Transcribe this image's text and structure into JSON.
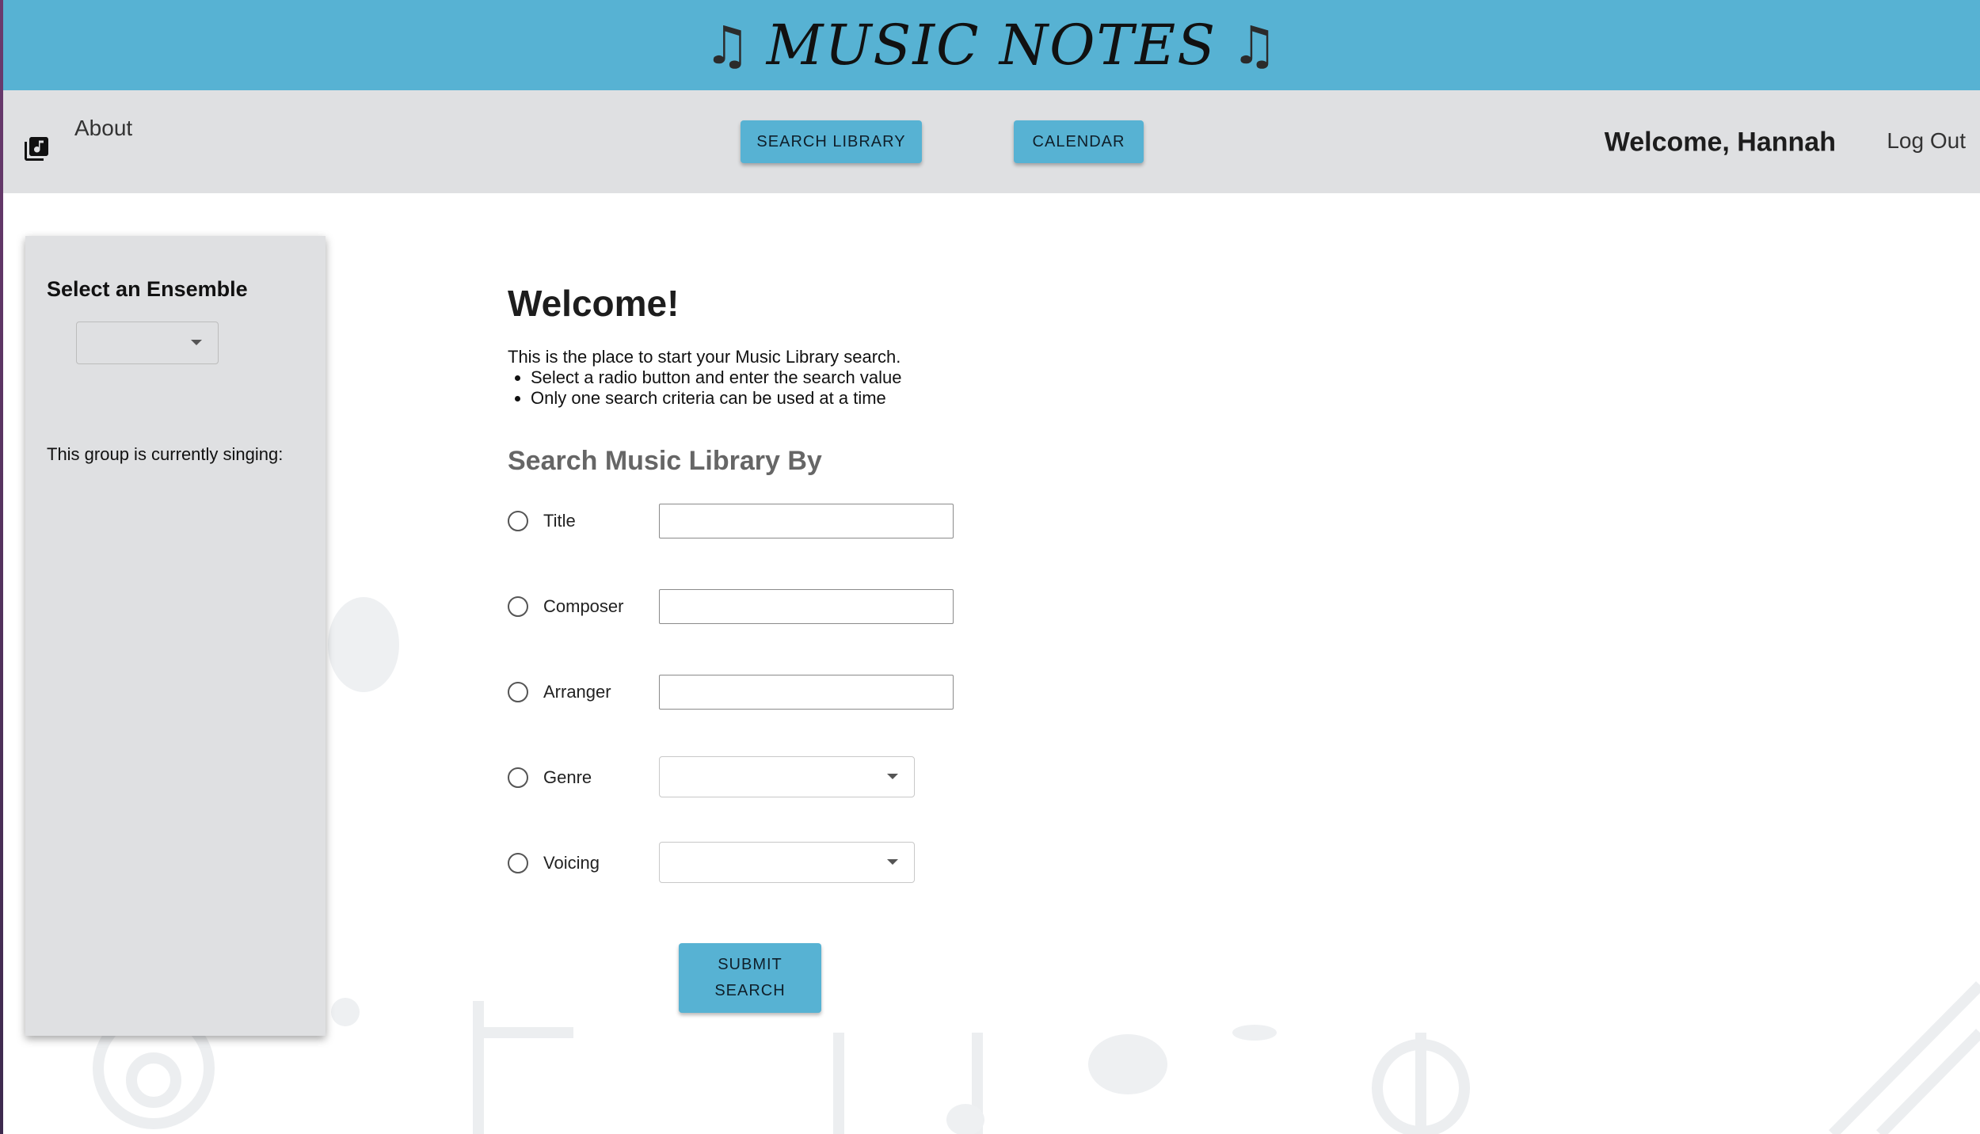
{
  "header": {
    "title": "MUSIC NOTES",
    "note_glyph": "♫",
    "background": "#57b2d3"
  },
  "nav": {
    "about": "About",
    "search_library": "SEARCH LIBRARY",
    "calendar": "CALENDAR",
    "welcome": "Welcome, Hannah",
    "logout": "Log Out",
    "icon": "music-library-icon"
  },
  "sidebar": {
    "title": "Select an Ensemble",
    "ensemble_value": "",
    "singing_text": "This group is currently singing:"
  },
  "main": {
    "title": "Welcome!",
    "intro": "This is the place to start your Music Library search.",
    "bullets": [
      "Select a radio button and enter the search value",
      "Only one search criteria can be used at a time"
    ],
    "search_heading": "Search Music Library By",
    "fields": [
      {
        "label": "Title",
        "value": ""
      },
      {
        "label": "Composer",
        "value": ""
      },
      {
        "label": "Arranger",
        "value": ""
      },
      {
        "label": "Genre",
        "value": ""
      },
      {
        "label": "Voicing",
        "value": ""
      }
    ],
    "submit_line1": "SUBMIT",
    "submit_line2": "SEARCH"
  },
  "colors": {
    "accent": "#57b2d3",
    "panel": "#dfe0e2"
  }
}
